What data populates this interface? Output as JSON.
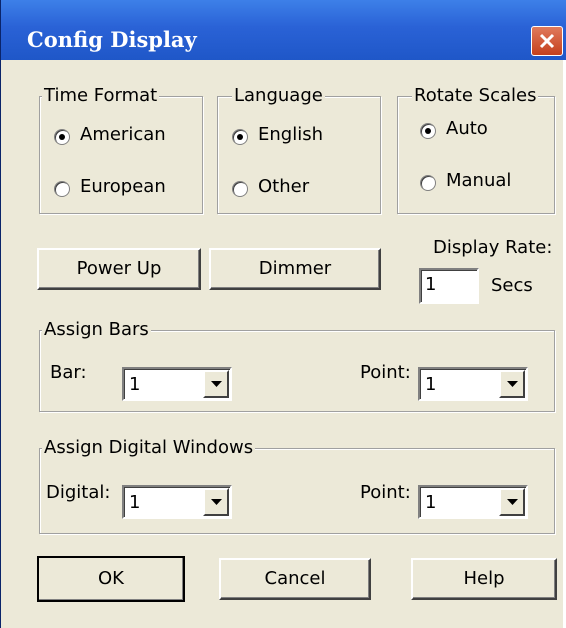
{
  "window": {
    "title": "Config Display"
  },
  "time_format": {
    "label": "Time Format",
    "options": [
      {
        "label": "American",
        "checked": true
      },
      {
        "label": "European",
        "checked": false
      }
    ]
  },
  "language": {
    "label": "Language",
    "options": [
      {
        "label": "English",
        "checked": true
      },
      {
        "label": "Other",
        "checked": false
      }
    ]
  },
  "rotate_scales": {
    "label": "Rotate Scales",
    "options": [
      {
        "label": "Auto",
        "checked": true
      },
      {
        "label": "Manual",
        "checked": false
      }
    ]
  },
  "buttons": {
    "power_up": "Power Up",
    "dimmer": "Dimmer",
    "ok": "OK",
    "cancel": "Cancel",
    "help": "Help"
  },
  "display_rate": {
    "label": "Display Rate:",
    "value": "1",
    "unit": "Secs"
  },
  "assign_bars": {
    "label": "Assign Bars",
    "bar_label": "Bar:",
    "bar_value": "1",
    "point_label": "Point:",
    "point_value": "1"
  },
  "assign_digital": {
    "label": "Assign Digital Windows",
    "digital_label": "Digital:",
    "digital_value": "1",
    "point_label": "Point:",
    "point_value": "1"
  }
}
